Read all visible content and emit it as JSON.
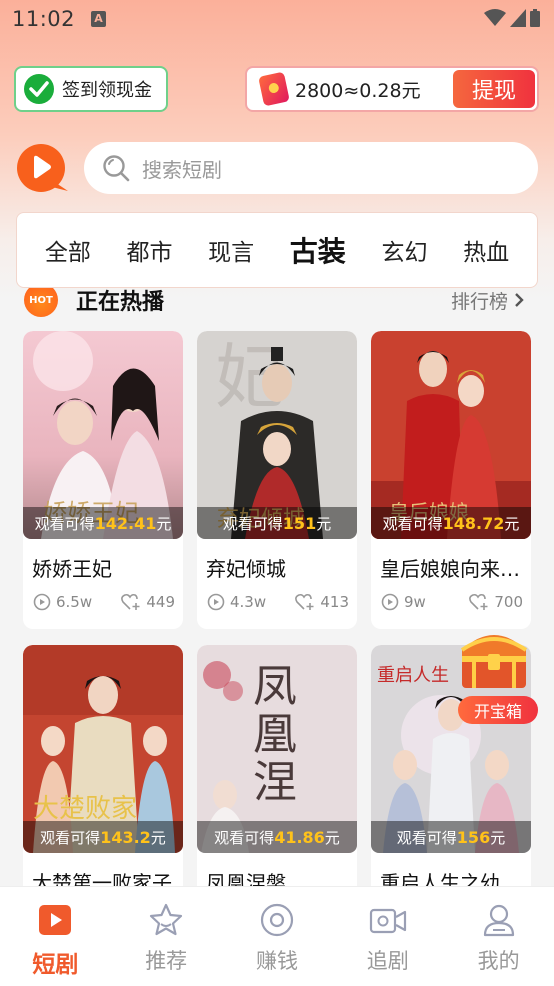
{
  "status_bar": {
    "time": "11:02",
    "notification_icon": "A"
  },
  "checkin": {
    "label": "签到领现金",
    "icon": "wechat-check-icon"
  },
  "coins": {
    "amount": "2800≈0.28元",
    "withdraw_label": "提现"
  },
  "search": {
    "placeholder": "搜索短剧"
  },
  "categories": [
    "全部",
    "都市",
    "现言",
    "古装",
    "玄幻",
    "热血"
  ],
  "active_category": "古装",
  "section": {
    "badge": "HOT",
    "title": "正在热播",
    "ranking_label": "排行榜"
  },
  "reward_prefix": "观看可得",
  "reward_suffix": "元",
  "cards": [
    {
      "title": "娇娇王妃",
      "reward": "142.41",
      "views": "6.5w",
      "likes": "449"
    },
    {
      "title": "弃妃倾城",
      "reward": "151",
      "views": "4.3w",
      "likes": "413"
    },
    {
      "title": "皇后娘娘向来…",
      "reward": "148.72",
      "views": "9w",
      "likes": "700"
    },
    {
      "title": "大楚第一败家子",
      "reward": "143.2"
    },
    {
      "title": "凤凰涅槃",
      "reward": "41.86"
    },
    {
      "title": "重启人生之幼",
      "reward": "156"
    }
  ],
  "treasure": {
    "label": "开宝箱"
  },
  "nav": [
    {
      "label": "短剧",
      "icon": "play-icon",
      "active": true
    },
    {
      "label": "推荐",
      "icon": "star-icon"
    },
    {
      "label": "赚钱",
      "icon": "coin-icon"
    },
    {
      "label": "追剧",
      "icon": "video-camera-icon"
    },
    {
      "label": "我的",
      "icon": "user-icon"
    }
  ],
  "colors": {
    "accent": "#f05a2c",
    "reward": "#ffc21a",
    "checkin_border": "#6fd08a"
  }
}
